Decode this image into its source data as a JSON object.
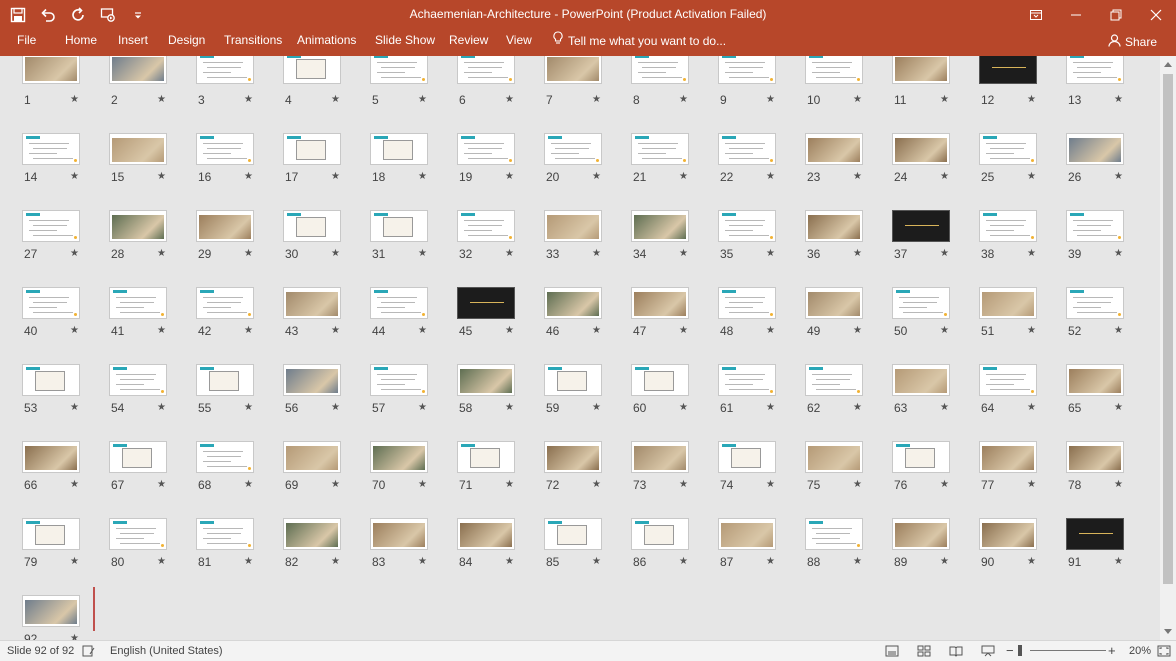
{
  "window": {
    "title": "Achaemenian-Architecture - PowerPoint (Product Activation Failed)"
  },
  "qat": {
    "icons": [
      "save-icon",
      "undo-icon",
      "redo-icon",
      "start-from-beginning-icon",
      "customize-qat-icon"
    ]
  },
  "ribbon": {
    "tabs": [
      "File",
      "Home",
      "Insert",
      "Design",
      "Transitions",
      "Animations",
      "Slide Show",
      "Review",
      "View"
    ],
    "tell_me": "Tell me what you want to do...",
    "share": "Share"
  },
  "sorter": {
    "star": "★",
    "total_slides": 92,
    "dark_slides": [
      12,
      37,
      45,
      91
    ],
    "photo_slides": [
      1,
      2,
      7,
      11,
      15,
      23,
      24,
      26,
      28,
      29,
      33,
      34,
      36,
      43,
      46,
      47,
      49,
      51,
      56,
      58,
      63,
      65,
      66,
      69,
      70,
      72,
      73,
      75,
      77,
      78,
      82,
      83,
      84,
      87,
      89,
      90,
      92
    ],
    "diagram_slides": [
      4,
      17,
      18,
      30,
      31,
      53,
      55,
      59,
      60,
      67,
      71,
      74,
      76,
      79,
      85,
      86
    ]
  },
  "colors": {
    "accent": "#b7472a",
    "slide_header": "#2aa7b7",
    "slide_marker": "#f2b233"
  },
  "status": {
    "slide_info": "Slide 92 of 92",
    "language": "English (United States)",
    "zoom": "20%",
    "zoom_minus": "−",
    "zoom_plus": "+"
  }
}
